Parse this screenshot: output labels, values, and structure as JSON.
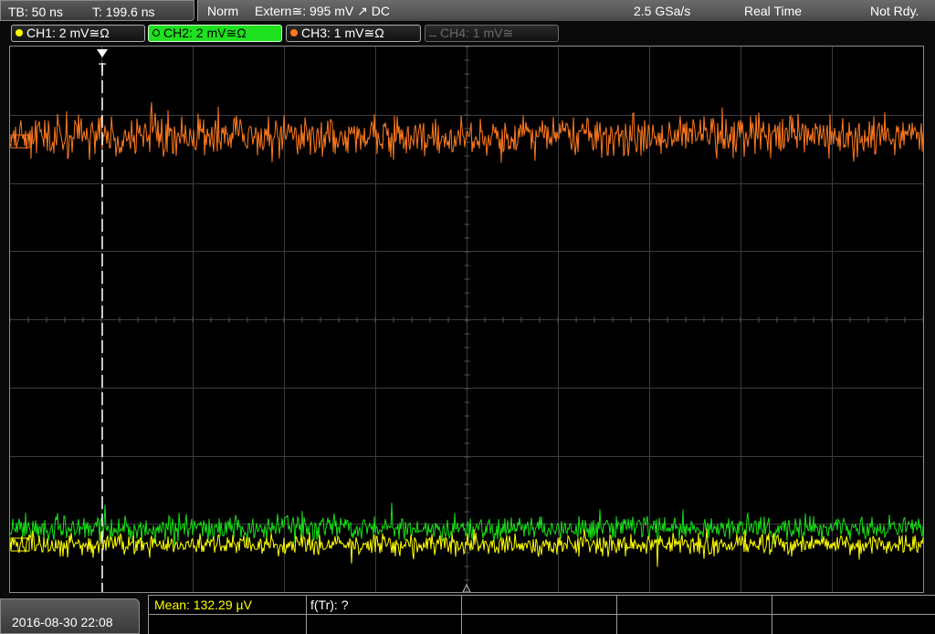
{
  "header": {
    "timebase": "TB: 50 ns",
    "trigger_time": "T: 199.6 ns",
    "mode": "Norm",
    "trigger_source": "Extern≅: 995 mV ↗ DC",
    "sample_rate": "2.5 GSa/s",
    "acquisition": "Real Time",
    "status": "Not Rdy."
  },
  "channels": [
    {
      "label": "CH1: 2 mV≅Ω",
      "color": "#ffff00",
      "state": "on"
    },
    {
      "label": "CH2: 2 mV≅Ω",
      "color": "#00e000",
      "state": "selected"
    },
    {
      "label": "CH3: 1 mV≅Ω",
      "color": "#ff7a1f",
      "state": "on"
    },
    {
      "label": "CH4: 1 mV≅",
      "color": "#6a6a6a",
      "state": "off"
    }
  ],
  "trigger_marker": {
    "label": "T"
  },
  "traces": {
    "ch3_color": "#ff7a1f",
    "ch2_color": "#16e016",
    "ch1_color": "#ffff00"
  },
  "footer": {
    "datetime": "2016-08-30 22:08",
    "measurement_1": "Mean: 132.29 µV",
    "measurement_2": "f(Tr): ?"
  }
}
